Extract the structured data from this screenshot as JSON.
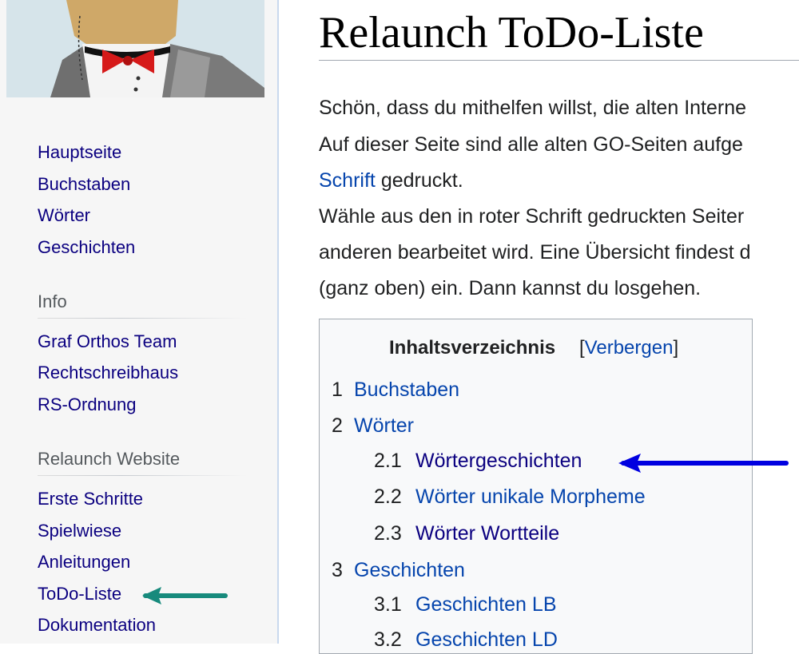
{
  "colors": {
    "link": "#0645ad",
    "visited_link": "#0b0080",
    "blue_arrow": "#0000e0",
    "teal_arrow": "#178a7c",
    "sidebar_bg": "#f6f6f6"
  },
  "sidebar": {
    "logo_icon": "cartoon-character-bowtie-icon",
    "nav": [
      "Hauptseite",
      "Buchstaben",
      "Wörter",
      "Geschichten"
    ],
    "info": {
      "heading": "Info",
      "items": [
        "Graf Orthos Team",
        "Rechtschreibhaus",
        "RS-Ordnung"
      ]
    },
    "relaunch": {
      "heading": "Relaunch Website",
      "items": [
        "Erste Schritte",
        "Spielwiese",
        "Anleitungen",
        "ToDo-Liste",
        "Dokumentation"
      ]
    }
  },
  "main": {
    "title": "Relaunch ToDo-Liste",
    "lines": [
      "Schön, dass du mithelfen willst, die alten Interne",
      "Auf dieser Seite sind alle alten GO-Seiten aufge",
      "gedruckt.",
      "Wähle aus den in roter Schrift gedruckten Seiter",
      "anderen bearbeitet wird. Eine Übersicht findest d",
      "(ganz oben) ein. Dann kannst du losgehen."
    ],
    "link_schrift": "Schrift"
  },
  "toc": {
    "title": "Inhaltsverzeichnis",
    "bracket_open": "[",
    "toggle": "Verbergen",
    "bracket_close": "]",
    "items": [
      {
        "num": "1",
        "text": "Buchstaben"
      },
      {
        "num": "2",
        "text": "Wörter"
      },
      {
        "num": "2.1",
        "text": "Wörtergeschichten"
      },
      {
        "num": "2.2",
        "text": "Wörter unikale Morpheme"
      },
      {
        "num": "2.3",
        "text": "Wörter Wortteile"
      },
      {
        "num": "3",
        "text": "Geschichten"
      },
      {
        "num": "3.1",
        "text": "Geschichten LB"
      },
      {
        "num": "3.2",
        "text": "Geschichten LD"
      }
    ]
  },
  "annotations": {
    "arrow1_icon": "blue-arrow-left-icon",
    "arrow2_icon": "teal-arrow-left-icon"
  }
}
